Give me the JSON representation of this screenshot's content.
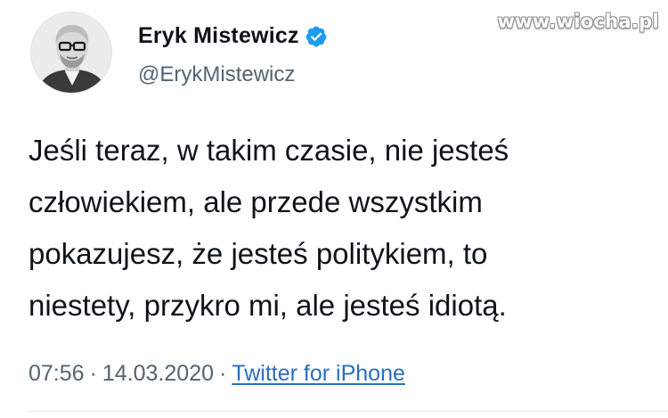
{
  "watermark": "www.wiocha.pl",
  "author": {
    "display_name": "Eryk Mistewicz",
    "handle": "@ErykMistewicz",
    "verified_icon": "verified-badge-icon",
    "verified_color": "#1d9bf0"
  },
  "tweet": {
    "lines": [
      "Jeśli teraz, w takim czasie, nie jesteś",
      "człowiekiem, ale przede wszystkim",
      "pokazujesz, że jesteś politykiem, to",
      "niestety, przykro mi, ale jesteś idiotą."
    ],
    "time": "07:56",
    "separator": "·",
    "date": "14.03.2020",
    "source": "Twitter for iPhone"
  },
  "colors": {
    "text": "#0f1419",
    "muted": "#536471",
    "link": "#2a6fbd"
  }
}
